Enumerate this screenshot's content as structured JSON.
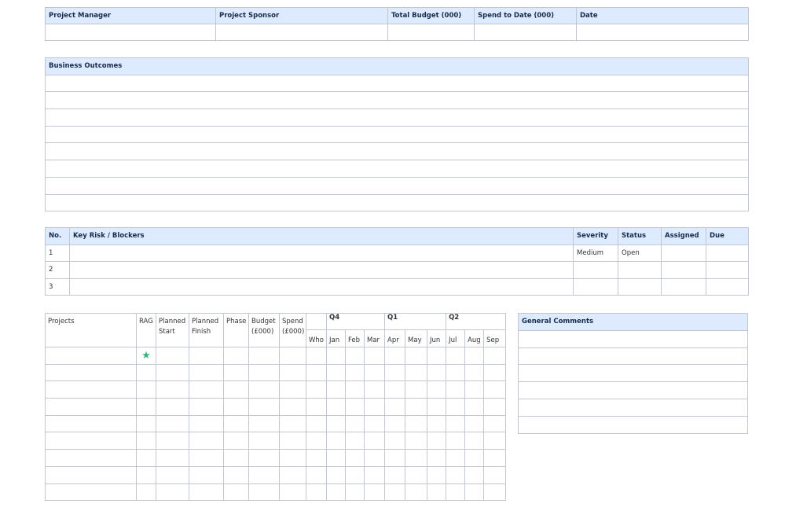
{
  "header_table": {
    "columns": [
      "Project Manager",
      "Project Sponsor",
      "Total Budget (000)",
      "Spend to Date (000)",
      "Date"
    ]
  },
  "outcomes_table": {
    "title": "Business Outcomes",
    "row_count": 8
  },
  "risk_table": {
    "columns": {
      "no": "No.",
      "key_risk": "Key Risk / Blockers",
      "severity": "Severity",
      "status": "Status",
      "assigned": "Assigned",
      "due": "Due"
    },
    "rows": [
      {
        "no": "1",
        "risk": "",
        "severity": "Medium",
        "status": "Open",
        "assigned": "",
        "due": ""
      },
      {
        "no": "2",
        "risk": "",
        "severity": "",
        "status": "",
        "assigned": "",
        "due": ""
      },
      {
        "no": "3",
        "risk": "",
        "severity": "",
        "status": "",
        "assigned": "",
        "due": ""
      }
    ]
  },
  "projects_table": {
    "columns": {
      "projects": "Projects",
      "rag": "RAG",
      "planned_start": "Planned Start",
      "planned_finish": "Planned Finish",
      "phase": "Phase",
      "budget": "Budget (£000)",
      "spend": "Spend (£000)"
    },
    "quarters": [
      "Q4",
      "Q1",
      "Q2"
    ],
    "months": [
      "Who",
      "Jan",
      "Feb",
      "Mar",
      "Apr",
      "May",
      "Jun",
      "Jul",
      "Aug",
      "Sep"
    ],
    "row_count": 9,
    "first_row_rag_icon": "star-icon",
    "rag_color": "#36b37e"
  },
  "comments_table": {
    "title": "General Comments",
    "row_count": 6
  }
}
